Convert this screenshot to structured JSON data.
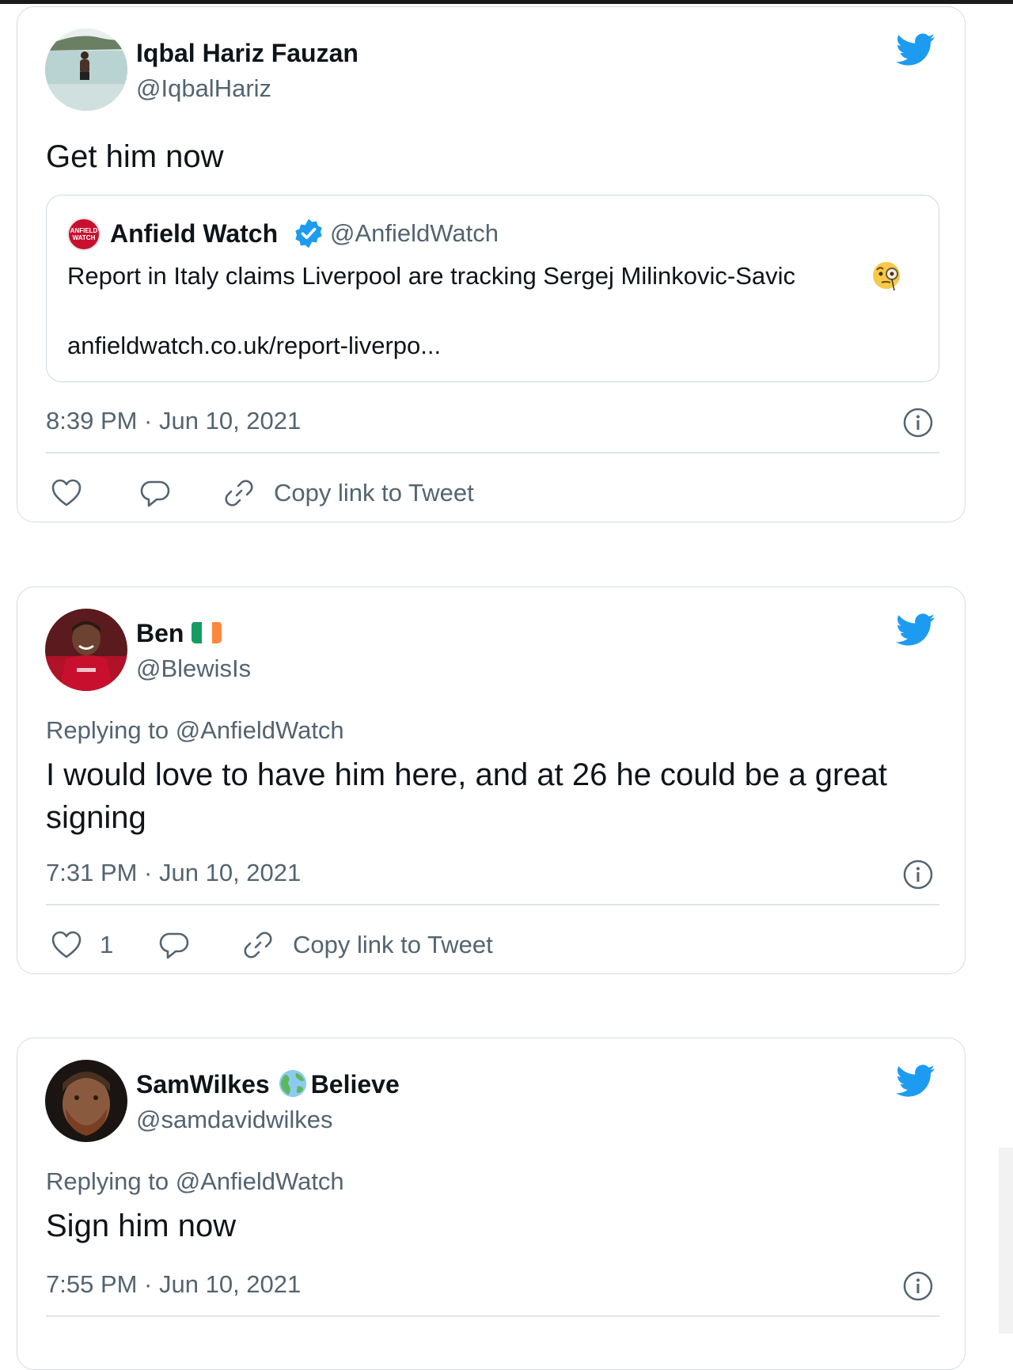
{
  "tweets": [
    {
      "name": "Iqbal Hariz Fauzan",
      "handle": "@IqbalHariz",
      "text": "Get him now",
      "quote": {
        "logo_text": "ANFIELD WATCH",
        "name": "Anfield Watch",
        "handle": "@AnfieldWatch",
        "text": "Report in Italy claims Liverpool are tracking Sergej Milinkovic-Savic",
        "link": "anfieldwatch.co.uk/report-liverpo..."
      },
      "time": "8:39 PM · Jun 10, 2021",
      "copy_link": "Copy link to Tweet"
    },
    {
      "name": "Ben",
      "handle": "@BlewisIs",
      "reply_prefix": "Replying to",
      "reply_to": "@AnfieldWatch",
      "text": "I would love to have him here, and at 26 he could be a great signing",
      "time": "7:31 PM · Jun 10, 2021",
      "likes": "1",
      "copy_link": "Copy link to Tweet"
    },
    {
      "name_part1": "SamWilkes",
      "name_part2": "Believe",
      "handle": "@samdavidwilkes",
      "reply_prefix": "Replying to",
      "reply_to": "@AnfieldWatch",
      "text": "Sign him now",
      "time": "7:55 PM · Jun 10, 2021"
    }
  ],
  "colors": {
    "twitter_blue": "#1d9bf0",
    "secondary_text": "#536471",
    "border": "#d5dce2",
    "irish_flag": [
      "#169b62",
      "#ffffff",
      "#ff883e"
    ]
  },
  "icons": [
    "twitter-bird-icon",
    "verified-badge-icon",
    "monocle-emoji-icon",
    "info-icon",
    "heart-icon",
    "reply-icon",
    "link-icon",
    "globe-emoji-icon",
    "ireland-flag-icon"
  ]
}
